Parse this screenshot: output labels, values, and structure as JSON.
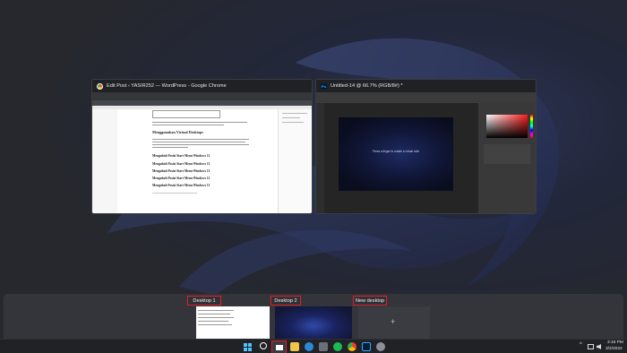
{
  "windows": [
    {
      "title": "Edit Post ‹ YASIR252 — WordPress - Google Chrome",
      "icon": "chrome-icon"
    },
    {
      "title": "Untitled-14 @ 66.7% (RGB/8#) *",
      "icon": "photoshop-icon"
    }
  ],
  "wordpress": {
    "heading": "Menggunakan Virtual Desktops",
    "subheadings": [
      "Mengubah Posisi Start Menu Windows 11",
      "Mengubah Posisi Start Menu Windows 11",
      "Mengubah Posisi Start Menu Windows 11",
      "Mengubah Posisi Start Menu Windows 11",
      "Mengubah Posisi Start Menu Windows 11"
    ]
  },
  "photoshop": {
    "canvas_text": "Press a finger to create a virtual note"
  },
  "desktops": [
    {
      "label": "Desktop 1"
    },
    {
      "label": "Desktop 2"
    },
    {
      "label": "New desktop",
      "plus": "+"
    }
  ],
  "taskbar": {
    "time": "3:16 PM",
    "date": "3/2/2022",
    "tray_chevron": "^",
    "icons": [
      "start-icon",
      "search-icon",
      "task-view-icon",
      "file-explorer-icon",
      "edge-icon",
      "store-icon",
      "spotify-icon",
      "chrome-icon",
      "photoshop-icon",
      "settings-icon"
    ]
  },
  "colors": {
    "highlight": "#e41e26",
    "accent": "#4cc2ff"
  }
}
